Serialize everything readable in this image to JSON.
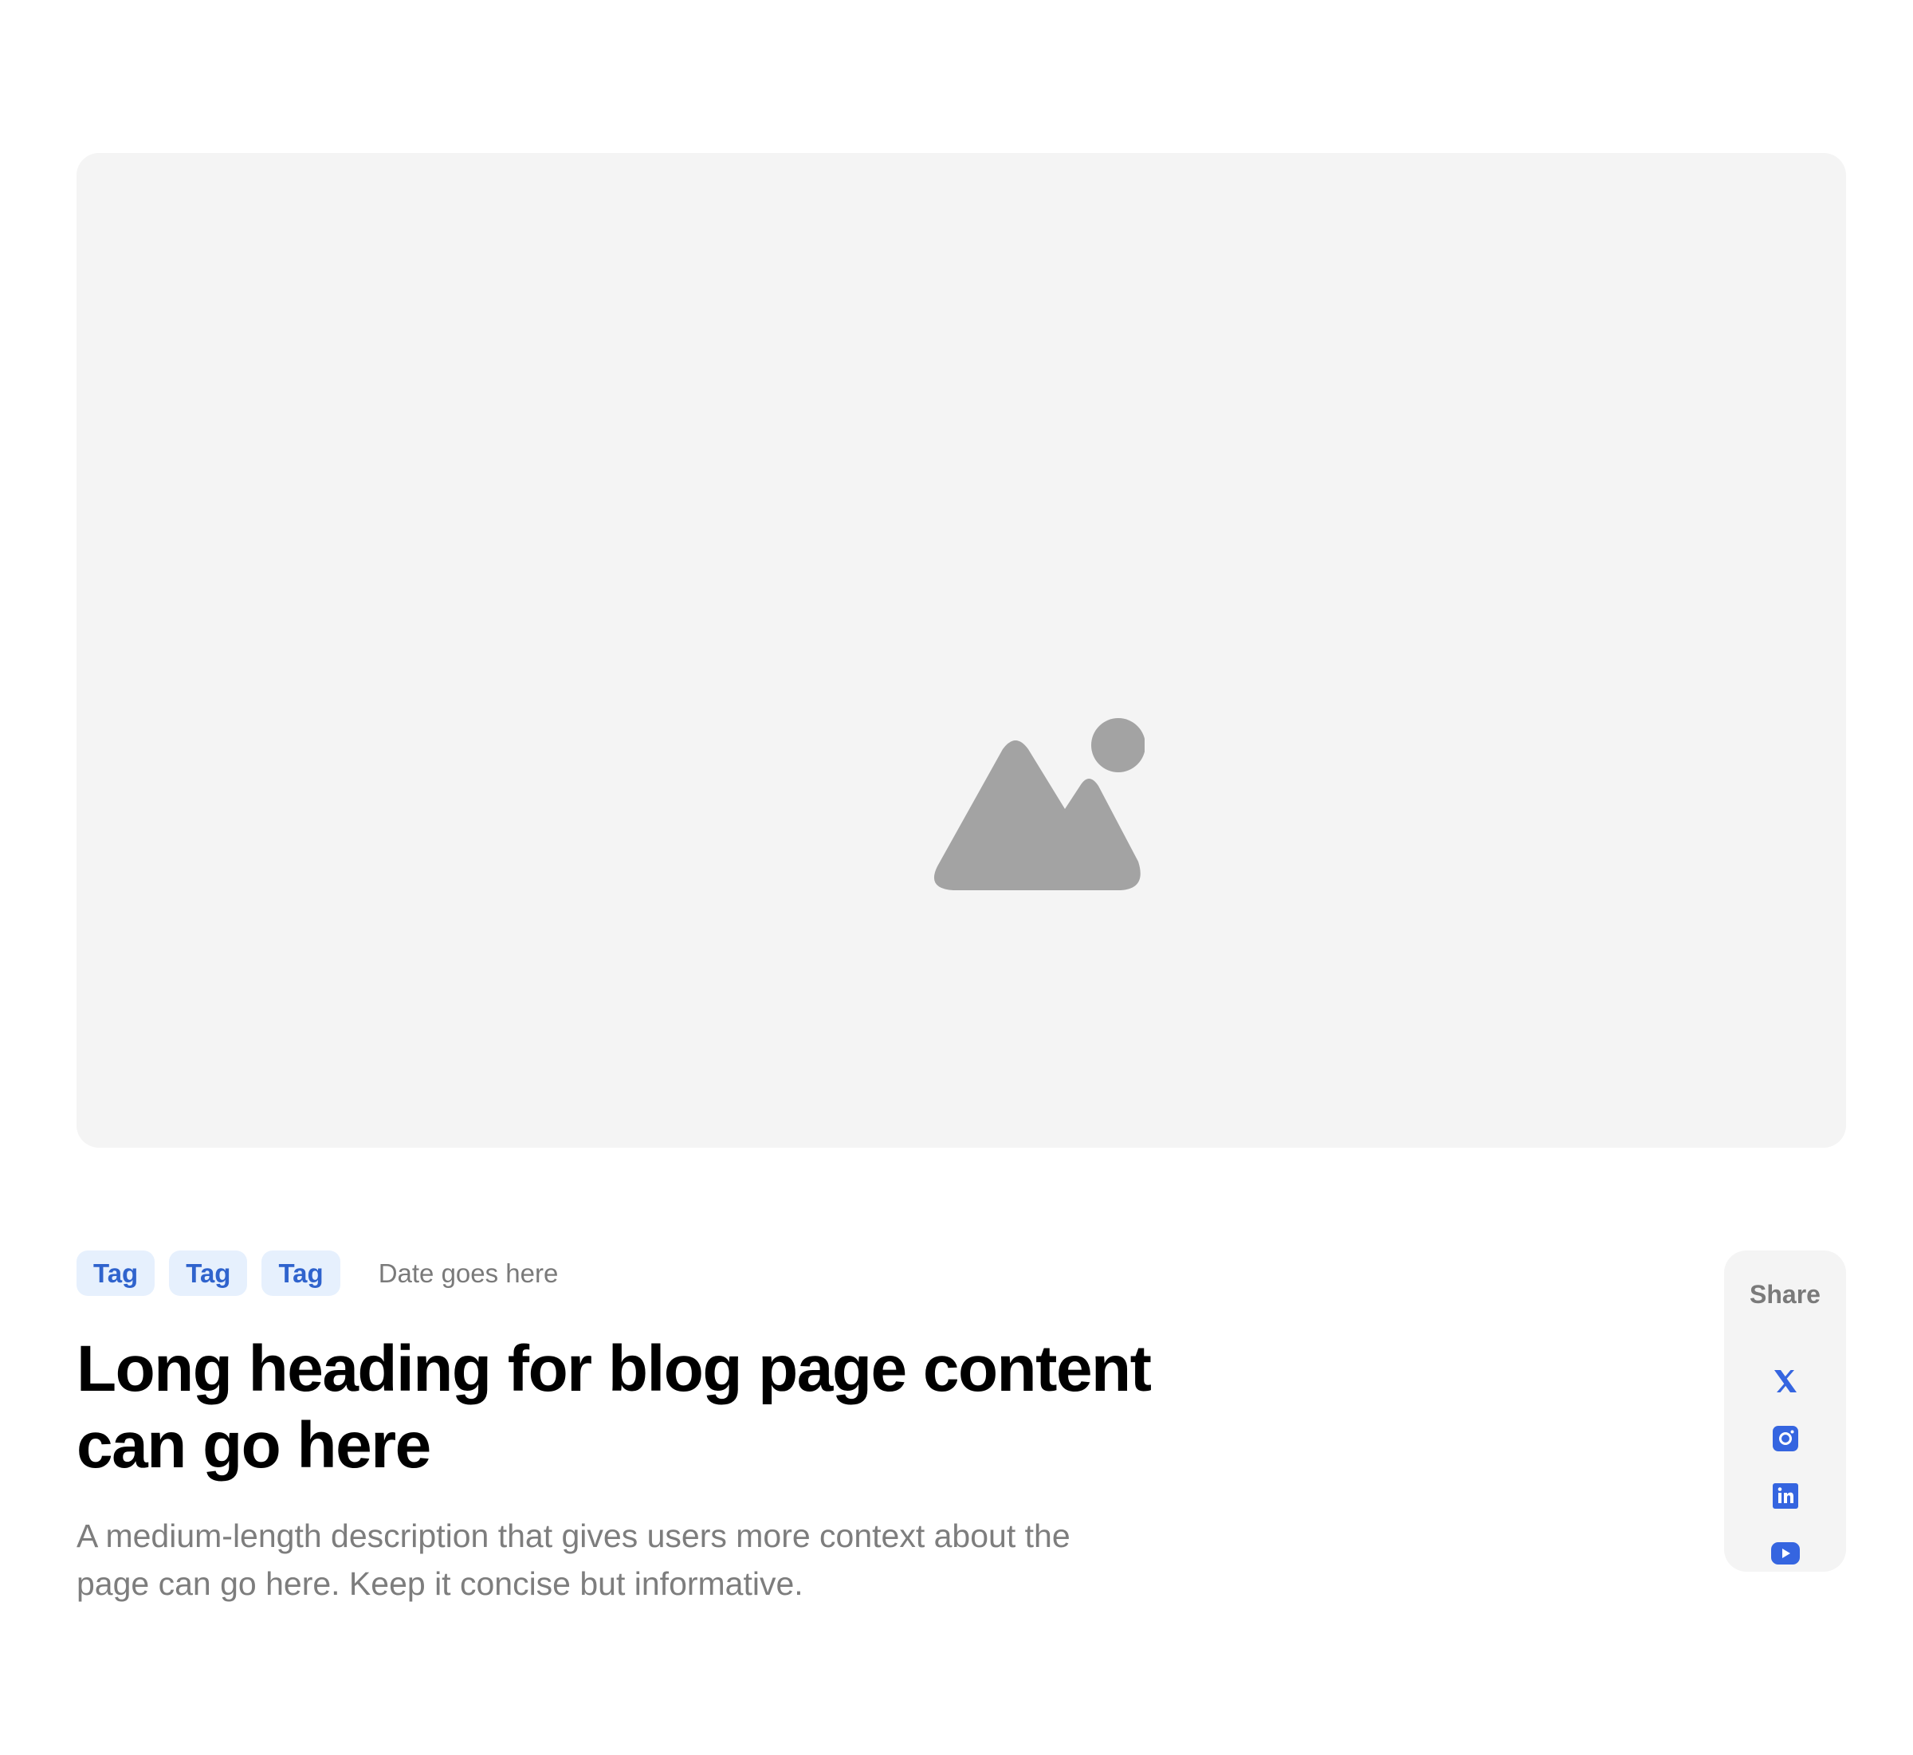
{
  "hero": {
    "image_icon": "image-placeholder-icon",
    "background_color": "#f4f4f4",
    "icon_color": "#a3a3a3"
  },
  "meta": {
    "tags": [
      "Tag",
      "Tag",
      "Tag"
    ],
    "date": "Date goes here"
  },
  "article": {
    "title": "Long heading for blog page content can go here",
    "description": "A medium-length description that gives users more context about the page can go here. Keep it concise but informative."
  },
  "share": {
    "label": "Share",
    "icons": [
      "x-icon",
      "instagram-icon",
      "linkedin-icon",
      "youtube-icon"
    ],
    "icon_color": "#3565e0"
  },
  "colors": {
    "tag_background": "#e6f0fd",
    "tag_text": "#2f63cd",
    "muted_text": "#7a7a7a"
  }
}
